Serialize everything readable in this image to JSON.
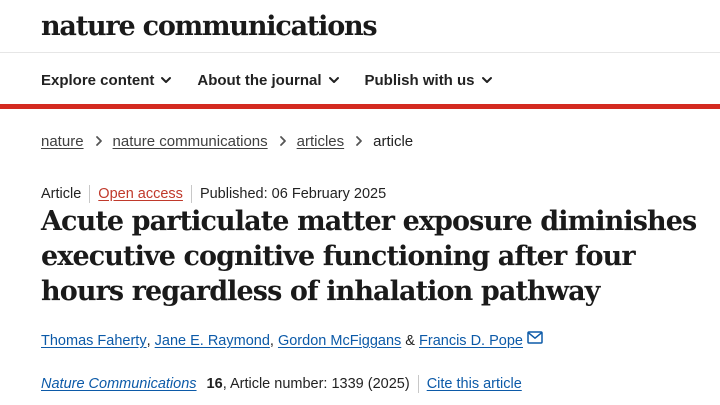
{
  "masthead": {
    "logo_text": "nature communications"
  },
  "nav": {
    "items": [
      {
        "label": "Explore content",
        "icon": "chevron-down-icon"
      },
      {
        "label": "About the journal",
        "icon": "chevron-down-icon"
      },
      {
        "label": "Publish with us",
        "icon": "chevron-down-icon"
      }
    ]
  },
  "colors": {
    "accent_bar": "#d42a20",
    "link": "#0c5aa8",
    "open_access": "#c0392b"
  },
  "breadcrumb": {
    "items": [
      "nature",
      "nature communications",
      "articles"
    ],
    "current": "article"
  },
  "article": {
    "type": "Article",
    "access": "Open access",
    "published": "Published: 06 February 2025",
    "title": "Acute particulate matter exposure diminishes executive cognitive functioning after four hours regardless of inhalation pathway",
    "authors": [
      "Thomas Faherty",
      "Jane E. Raymond",
      "Gordon McFiggans",
      "Francis D. Pope"
    ],
    "author_separators": [
      ", ",
      ", ",
      " & "
    ],
    "contact_icon": "mail-icon"
  },
  "citation": {
    "journal": "Nature Communications",
    "volume": "16",
    "article_number": ", Article number: 1339 (2025)",
    "cite_label": "Cite this article"
  }
}
